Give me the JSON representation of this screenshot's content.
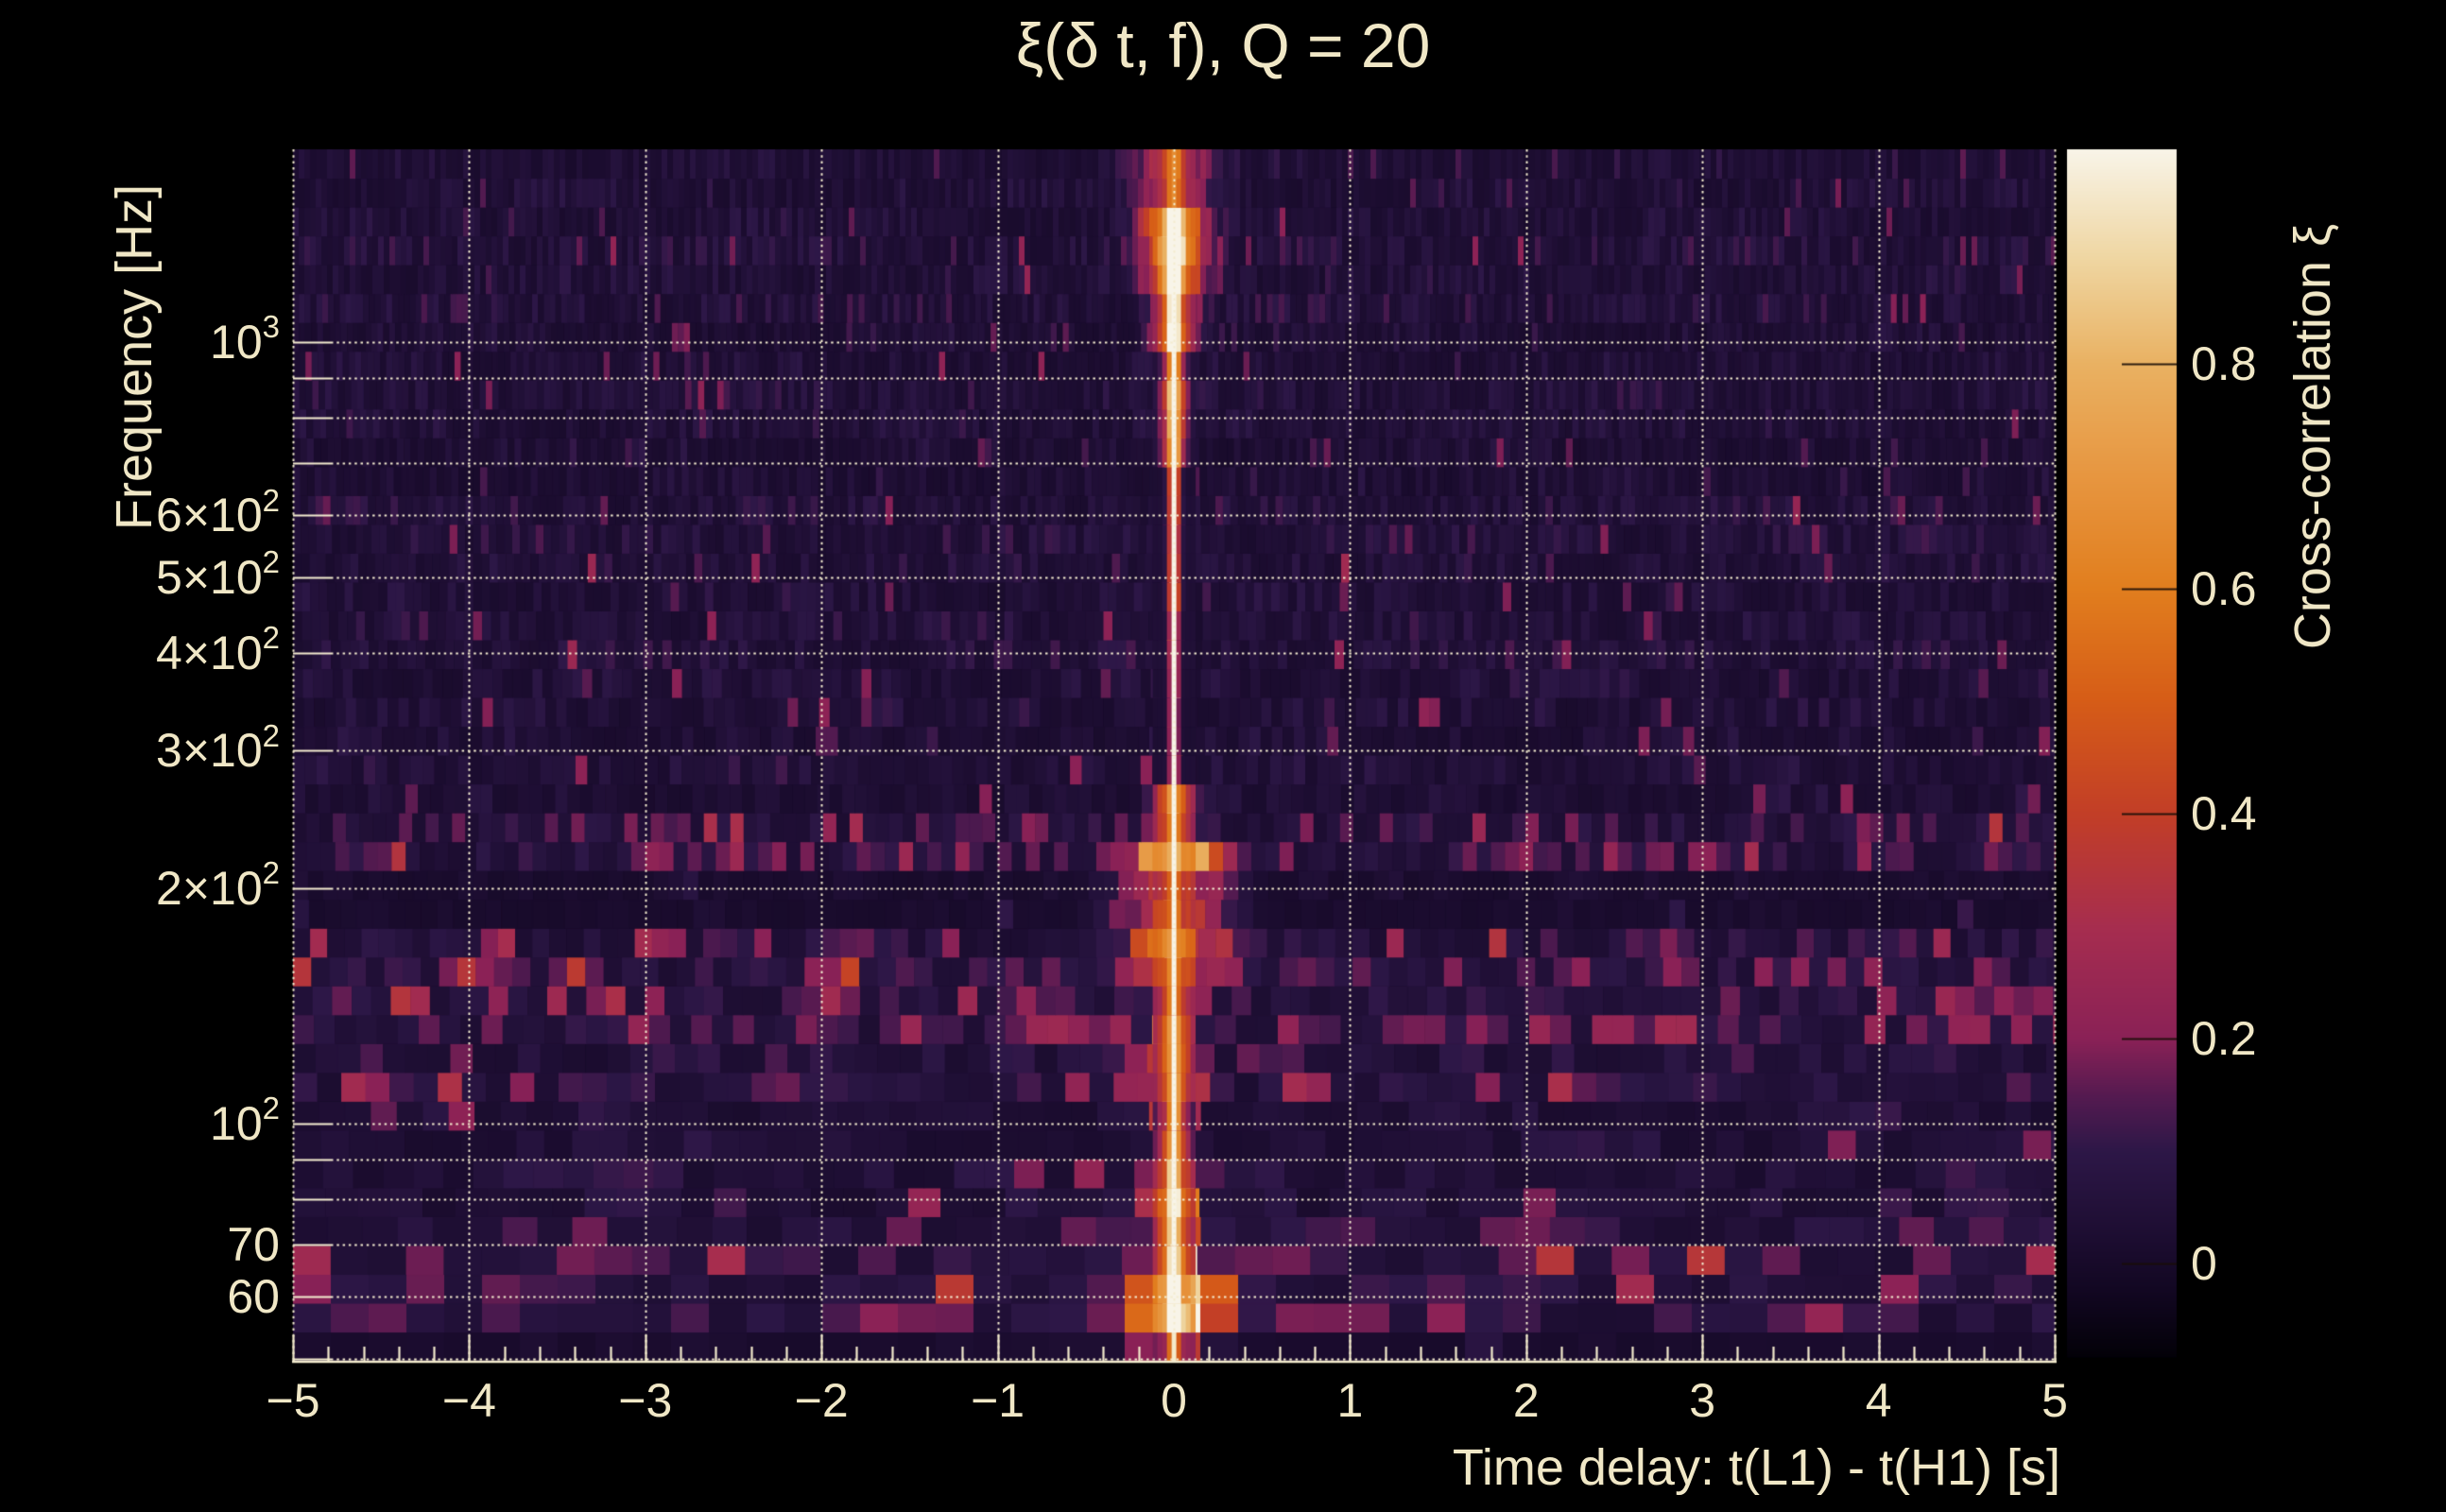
{
  "title": "ξ(δ t, f), Q = 20",
  "x_axis": {
    "label": "Time delay: t(L1) - t(H1) [s]",
    "range": [
      -5,
      5
    ],
    "minor_step": 0.2,
    "ticks": [
      {
        "value": -5,
        "label": "−5"
      },
      {
        "value": -4,
        "label": "−4"
      },
      {
        "value": -3,
        "label": "−3"
      },
      {
        "value": -2,
        "label": "−2"
      },
      {
        "value": -1,
        "label": "−1"
      },
      {
        "value": 0,
        "label": "0"
      },
      {
        "value": 1,
        "label": "1"
      },
      {
        "value": 2,
        "label": "2"
      },
      {
        "value": 3,
        "label": "3"
      },
      {
        "value": 4,
        "label": "4"
      },
      {
        "value": 5,
        "label": "5"
      }
    ]
  },
  "y_axis": {
    "label": "Frequency [Hz]",
    "scale": "log",
    "range_hz": [
      49.7,
      1765
    ],
    "ticks": [
      {
        "f": 1000,
        "prefix": "",
        "base": "10",
        "exp": "3"
      },
      {
        "f": 600,
        "prefix": "6×",
        "base": "10",
        "exp": "2"
      },
      {
        "f": 500,
        "prefix": "5×",
        "base": "10",
        "exp": "2"
      },
      {
        "f": 400,
        "prefix": "4×",
        "base": "10",
        "exp": "2"
      },
      {
        "f": 300,
        "prefix": "3×",
        "base": "10",
        "exp": "2"
      },
      {
        "f": 200,
        "prefix": "2×",
        "base": "10",
        "exp": "2"
      },
      {
        "f": 100,
        "prefix": "",
        "base": "10",
        "exp": "2"
      },
      {
        "f": 70,
        "prefix": "",
        "base": "70",
        "exp": ""
      },
      {
        "f": 60,
        "prefix": "",
        "base": "60",
        "exp": ""
      }
    ],
    "gridline_freqs": [
      1000,
      900,
      800,
      700,
      600,
      500,
      400,
      300,
      200,
      100,
      90,
      80,
      70,
      60,
      50
    ]
  },
  "colorbar": {
    "label": "Cross-correlation ξ",
    "range": [
      -0.082,
      0.991
    ],
    "ticks": [
      {
        "value": 0.8,
        "label": "0.8"
      },
      {
        "value": 0.6,
        "label": "0.6"
      },
      {
        "value": 0.4,
        "label": "0.4"
      },
      {
        "value": 0.2,
        "label": "0.2"
      },
      {
        "value": 0.0,
        "label": "0"
      }
    ]
  },
  "colors": {
    "background": "#000000",
    "text": "#f0e7c6",
    "grid": "#f4ecd0",
    "axis": "#f3ebcd",
    "colormap_stops": [
      [
        0.0,
        "#030108"
      ],
      [
        0.055,
        "#120722"
      ],
      [
        0.105,
        "#1e0e33"
      ],
      [
        0.17,
        "#2d1747"
      ],
      [
        0.215,
        "#541a50"
      ],
      [
        0.263,
        "#8a2156"
      ],
      [
        0.355,
        "#a62d4f"
      ],
      [
        0.449,
        "#c23e27"
      ],
      [
        0.545,
        "#d65d17"
      ],
      [
        0.636,
        "#e17e1e"
      ],
      [
        0.73,
        "#e79640"
      ],
      [
        0.822,
        "#e9b162"
      ],
      [
        0.91,
        "#efd6a2"
      ],
      [
        1.0,
        "#f8f4e8"
      ]
    ]
  },
  "chart_data": {
    "type": "heatmap",
    "title": "ξ(δ t, f), Q = 20",
    "xlabel": "Time delay: t(L1) - t(H1) [s]",
    "ylabel": "Frequency [Hz]",
    "colorbar_label": "Cross-correlation ξ",
    "xlim": [
      -5,
      5
    ],
    "ylim_hz": [
      49.7,
      1765
    ],
    "y_scale": "log",
    "value_range": [
      -0.082,
      0.991
    ],
    "grid": "dotted, cream, at integer time delays and at log-decade subdivisions",
    "legend_position": "right colorbar",
    "description": "Q-transform cross-correlation spectrogram between L1 and H1. A narrow near-white ridge of high correlation (ξ ≈ 0.9–0.99) runs vertically at δt ≈ 0 across all frequencies, widening into an orange blob above ~1000 Hz, with broad patchy orange wings near 150–250 Hz and a bright low-frequency blob near 55–65 Hz. Background is dark purple noise (ξ ≈ 0–0.15) with mottled vertical striping; nearly black horizontal bands appear at ~185–215 Hz and ~92–105 Hz.",
    "features": [
      {
        "name": "central-ridge",
        "dt": 0.0,
        "width_s": 0.05,
        "peak_xi": 0.97,
        "freq_span_hz": [
          50,
          1550
        ]
      },
      {
        "name": "high-frequency-blob",
        "dt_span": [
          -0.45,
          0.45
        ],
        "freq_span_hz": [
          950,
          1765
        ],
        "peak_xi": 0.65
      },
      {
        "name": "mid-band-wings",
        "dt_span": [
          -0.6,
          0.6
        ],
        "freq_span_hz": [
          150,
          250
        ],
        "peak_xi": 0.55
      },
      {
        "name": "low-frequency-blob",
        "dt_span": [
          -0.8,
          0.5
        ],
        "freq_span_hz": [
          54,
          65
        ],
        "peak_xi": 0.72
      },
      {
        "name": "dark-band",
        "freq_span_hz": [
          185,
          215
        ],
        "xi": 0.02
      },
      {
        "name": "dark-band",
        "freq_span_hz": [
          92,
          105
        ],
        "xi": 0.04
      },
      {
        "name": "background-noise",
        "xi_range": [
          0.0,
          0.15
        ]
      }
    ],
    "render": {
      "seed": 7,
      "nrows": 42,
      "noise_bands": [
        {
          "fmin": 1500,
          "fmax": 1800,
          "base": 0.035,
          "spike_p": 0.03,
          "spike_a": 0.1
        },
        {
          "fmin": 900,
          "fmax": 1500,
          "base": 0.05,
          "spike_p": 0.04,
          "spike_a": 0.12
        },
        {
          "fmin": 600,
          "fmax": 900,
          "base": 0.045,
          "spike_p": 0.04,
          "spike_a": 0.1
        },
        {
          "fmin": 250,
          "fmax": 600,
          "base": 0.05,
          "spike_p": 0.05,
          "spike_a": 0.12
        },
        {
          "fmin": 215,
          "fmax": 250,
          "base": 0.09,
          "spike_p": 0.1,
          "spike_a": 0.15
        },
        {
          "fmin": 185,
          "fmax": 215,
          "base": 0.018,
          "spike_p": 0.03,
          "spike_a": 0.08
        },
        {
          "fmin": 130,
          "fmax": 185,
          "base": 0.105,
          "spike_p": 0.12,
          "spike_a": 0.16
        },
        {
          "fmin": 105,
          "fmax": 130,
          "base": 0.08,
          "spike_p": 0.08,
          "spike_a": 0.14
        },
        {
          "fmin": 92,
          "fmax": 105,
          "base": 0.04,
          "spike_p": 0.04,
          "spike_a": 0.1
        },
        {
          "fmin": 72,
          "fmax": 92,
          "base": 0.065,
          "spike_p": 0.06,
          "spike_a": 0.12
        },
        {
          "fmin": 54,
          "fmax": 72,
          "base": 0.085,
          "spike_p": 0.08,
          "spike_a": 0.14
        },
        {
          "fmin": 40,
          "fmax": 54,
          "base": 0.02,
          "spike_p": 0.02,
          "spike_a": 0.06
        }
      ],
      "signal_bands": [
        {
          "fmin": 1550,
          "fmax": 1800,
          "core": 0.32,
          "cs": 0.05,
          "flank": 0.28,
          "fs": 0.22,
          "patchy": 0.45
        },
        {
          "fmin": 1150,
          "fmax": 1550,
          "core": 0.62,
          "cs": 0.05,
          "flank": 0.55,
          "fs": 0.17,
          "patchy": 0.4
        },
        {
          "fmin": 950,
          "fmax": 1150,
          "core": 0.85,
          "cs": 0.035,
          "flank": 0.5,
          "fs": 0.12,
          "patchy": 0.35
        },
        {
          "fmin": 700,
          "fmax": 950,
          "core": 0.93,
          "cs": 0.022,
          "flank": 0.55,
          "fs": 0.065,
          "patchy": 0.3
        },
        {
          "fmin": 450,
          "fmax": 700,
          "core": 0.94,
          "cs": 0.017,
          "flank": 0.42,
          "fs": 0.035,
          "patchy": 0.3
        },
        {
          "fmin": 280,
          "fmax": 450,
          "core": 0.93,
          "cs": 0.015,
          "flank": 0.38,
          "fs": 0.028,
          "patchy": 0.35
        },
        {
          "fmin": 230,
          "fmax": 280,
          "core": 0.92,
          "cs": 0.017,
          "flank": 0.45,
          "fs": 0.11,
          "patchy": 0.55
        },
        {
          "fmin": 150,
          "fmax": 230,
          "core": 0.94,
          "cs": 0.019,
          "flank": 0.52,
          "fs": 0.27,
          "patchy": 0.65
        },
        {
          "fmin": 105,
          "fmax": 150,
          "core": 0.92,
          "cs": 0.02,
          "flank": 0.46,
          "fs": 0.12,
          "patchy": 0.55
        },
        {
          "fmin": 88,
          "fmax": 105,
          "core": 0.9,
          "cs": 0.022,
          "flank": 0.42,
          "fs": 0.09,
          "patchy": 0.45
        },
        {
          "fmin": 64,
          "fmax": 88,
          "core": 0.93,
          "cs": 0.024,
          "flank": 0.5,
          "fs": 0.13,
          "patchy": 0.5
        },
        {
          "fmin": 54,
          "fmax": 64,
          "core": 0.96,
          "cs": 0.028,
          "flank": 0.62,
          "fs": 0.3,
          "patchy": 0.55
        },
        {
          "fmin": 40,
          "fmax": 54,
          "core": 0.72,
          "cs": 0.028,
          "flank": 0.3,
          "fs": 0.25,
          "patchy": 0.5
        }
      ]
    }
  }
}
